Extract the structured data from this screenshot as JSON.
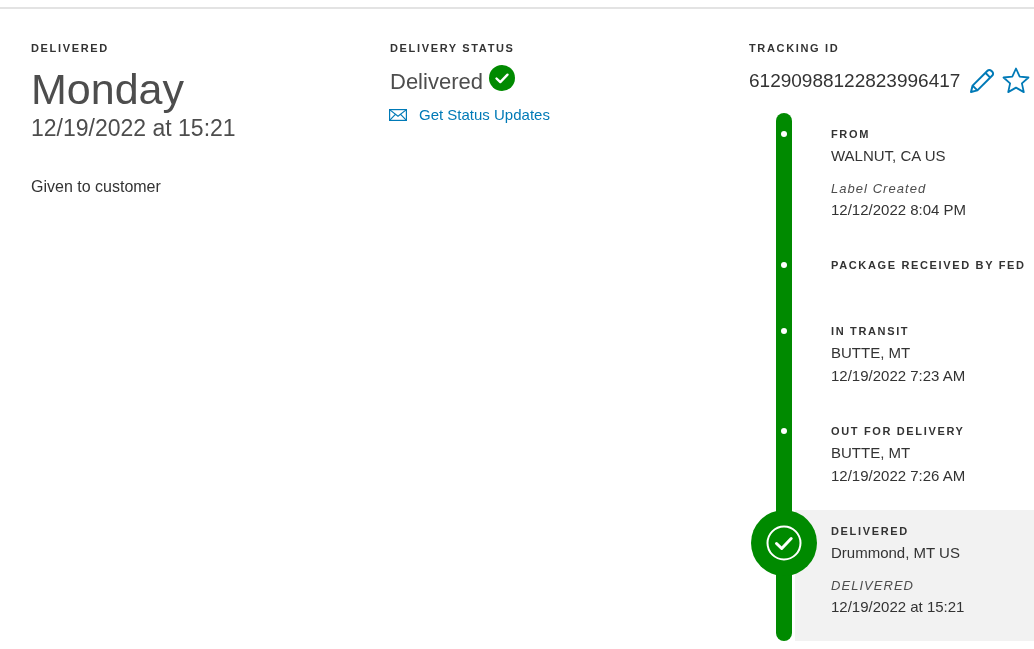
{
  "summary": {
    "label": "DELIVERED",
    "day": "Monday",
    "datetime": "12/19/2022 at 15:21",
    "detail": "Given to customer"
  },
  "delivery_status": {
    "label": "DELIVERY STATUS",
    "status": "Delivered",
    "delivered": true,
    "updates_link": "Get Status Updates"
  },
  "tracking": {
    "label": "TRACKING ID",
    "number": "61290988122823996417",
    "starred": false
  },
  "travel_history": [
    {
      "title": "FROM",
      "location": "WALNUT, CA US",
      "note": "Label Created",
      "time": "12/12/2022 8:04 PM",
      "current": false
    },
    {
      "title": "PACKAGE RECEIVED BY FED",
      "current": false
    },
    {
      "title": "IN TRANSIT",
      "location": "BUTTE, MT",
      "time": "12/19/2022 7:23 AM",
      "current": false
    },
    {
      "title": "OUT FOR DELIVERY",
      "location": "BUTTE, MT",
      "time": "12/19/2022 7:26 AM",
      "current": false
    },
    {
      "title": "DELIVERED",
      "location": "Drummond, MT US",
      "note": "DELIVERED",
      "time": "12/19/2022 at 15:21",
      "current": true
    }
  ]
}
